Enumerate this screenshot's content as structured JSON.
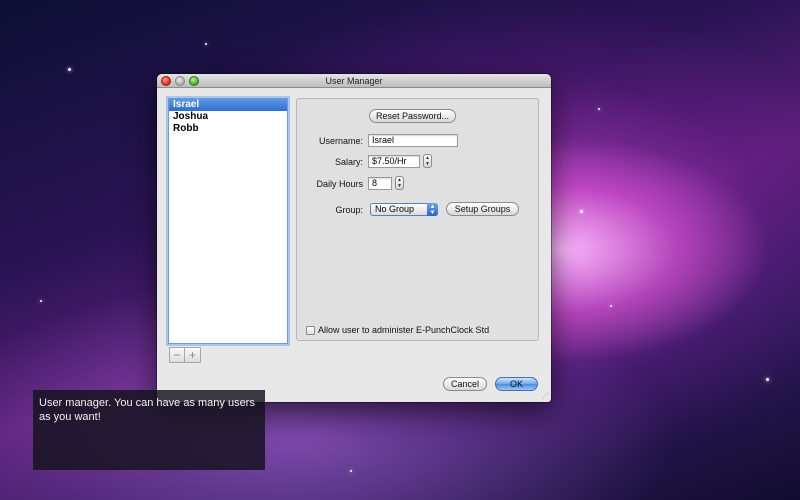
{
  "window": {
    "title": "User Manager"
  },
  "users": [
    "Israel",
    "Joshua",
    "Robb"
  ],
  "selected_user_index": 0,
  "list_buttons": {
    "remove": "−",
    "add": "+"
  },
  "details": {
    "reset_password_label": "Reset Password...",
    "username_label": "Username:",
    "username_value": "Israel",
    "salary_label": "Salary:",
    "salary_value": "$7.50/Hr",
    "daily_hours_label": "Daily Hours",
    "daily_hours_value": "8",
    "group_label": "Group:",
    "group_value": "No Group",
    "setup_groups_label": "Setup Groups",
    "admin_checkbox_label": "Allow user to administer E-PunchClock Std",
    "admin_checked": false
  },
  "footer": {
    "cancel_label": "Cancel",
    "ok_label": "OK"
  },
  "caption": {
    "text": "User manager. You can have as many users as you want!"
  },
  "icons": {
    "stepper_up": "▲",
    "stepper_down": "▼",
    "resize_grip": "⋰"
  },
  "colors": {
    "selection": "#3b78d8",
    "ok_button": "#5c97e6"
  }
}
